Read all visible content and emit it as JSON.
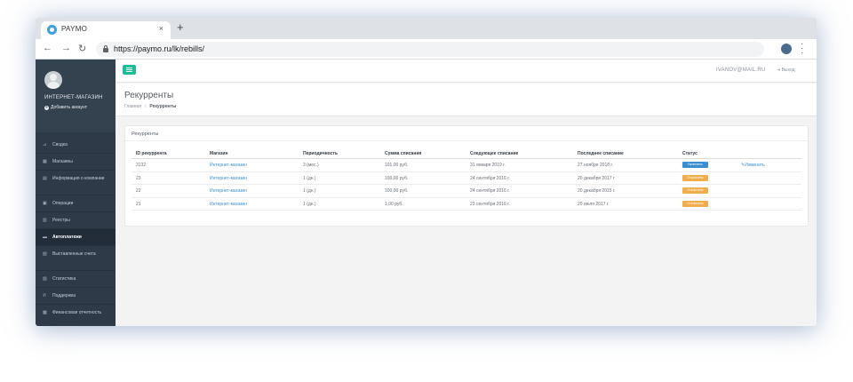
{
  "browser": {
    "tab_title": "PAYMO",
    "tab_close": "×",
    "new_tab": "+",
    "url": "https://paymo.ru/lk/rebills/"
  },
  "sidebar": {
    "shop_name": "ИНТЕРНЕТ-МАГАЗИН",
    "add_account": "Добавить аккаунт",
    "items": [
      {
        "label": "Сводка",
        "icon": "chart-line-icon",
        "glyph": "⊿"
      },
      {
        "label": "Магазины",
        "icon": "store-icon",
        "glyph": "▦"
      },
      {
        "label": "Информация о компании",
        "icon": "info-icon",
        "glyph": "▤"
      },
      {
        "label": "Операции",
        "icon": "operations-icon",
        "glyph": "▣"
      },
      {
        "label": "Реестры",
        "icon": "registry-icon",
        "glyph": "▥"
      },
      {
        "label": "Автоплатежи",
        "icon": "autopay-icon",
        "glyph": "▬"
      },
      {
        "label": "Выставленные счета",
        "icon": "invoices-icon",
        "glyph": "▧"
      },
      {
        "label": "Статистика",
        "icon": "statistics-icon",
        "glyph": "▨"
      },
      {
        "label": "Поддержка",
        "icon": "phone-icon",
        "glyph": "✆"
      },
      {
        "label": "Финансовая отчетность",
        "icon": "report-icon",
        "glyph": "▩"
      },
      {
        "label": "Настройки",
        "icon": "gear-icon",
        "glyph": "⚙"
      }
    ],
    "active_index": 5
  },
  "topbar": {
    "user_email": "IVANOV@MAIL.RU",
    "logout": "Выход",
    "logout_glyph": "⇥"
  },
  "page": {
    "title": "Рекурренты",
    "breadcrumb_home": "Главная",
    "breadcrumb_sep": "/",
    "breadcrumb_current": "Рекурренты"
  },
  "panel": {
    "title": "Рекурренты",
    "columns": [
      "ID рекуррента",
      "Магазин",
      "Периодичность",
      "Сумма списания",
      "Следующее списание",
      "Последнее списание",
      "Статус"
    ],
    "rows": [
      {
        "id": "3132",
        "shop": "Интернет-магазин",
        "period": "3 (мес.)",
        "amount": "101,00 руб.",
        "next": "31 января 2019 г.",
        "last": "27 ноября 2018 г.",
        "status": "Включено",
        "status_type": "on",
        "edit": "Изменить"
      },
      {
        "id": "23",
        "shop": "Интернет-магазин",
        "period": "1 (дн.)",
        "amount": "100,00 руб.",
        "next": "24 сентября 2016 г.",
        "last": "20 декабря 2017 г.",
        "status": "Отключено",
        "status_type": "off",
        "edit": ""
      },
      {
        "id": "22",
        "shop": "Интернет-магазин",
        "period": "1 (дн.)",
        "amount": "100,00 руб.",
        "next": "24 сентября 2016 г.",
        "last": "20 декабря 2015 г.",
        "status": "Отключено",
        "status_type": "off",
        "edit": ""
      },
      {
        "id": "21",
        "shop": "Интернет-магазин",
        "period": "1 (дн.)",
        "amount": "1,00 руб.",
        "next": "23 сентября 2016 г.",
        "last": "20 июля 2017 г.",
        "status": "Отключено",
        "status_type": "off",
        "edit": ""
      }
    ]
  },
  "colors": {
    "sidebar_bg": "#2e3a48",
    "accent": "#1abc9c",
    "link": "#3b8fce",
    "badge_on": "#3a8fd0",
    "badge_off": "#f0ad4e"
  }
}
